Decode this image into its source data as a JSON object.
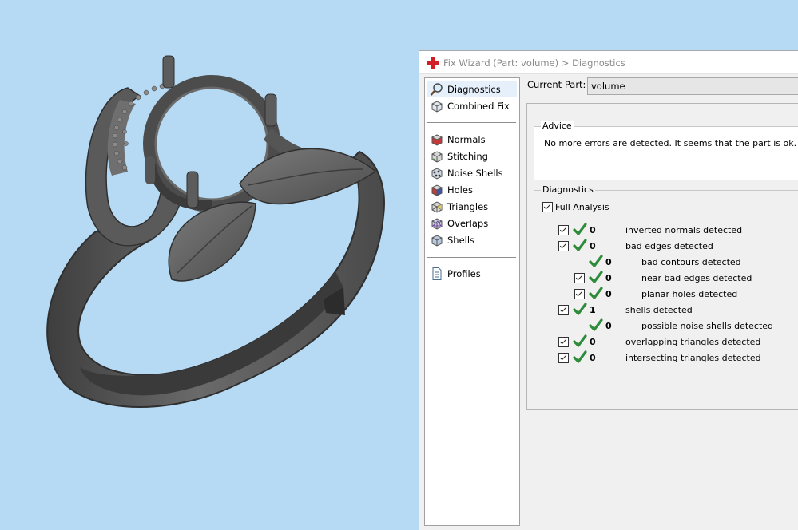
{
  "window": {
    "title": "Fix Wizard (Part: volume) > Diagnostics",
    "icon": "red-cross-icon"
  },
  "nav": {
    "top_items": [
      {
        "label": "Diagnostics",
        "icon": "magnifier-icon",
        "selected": true
      },
      {
        "label": "Combined Fix",
        "icon": "cube-icon",
        "selected": false
      }
    ],
    "tool_items": [
      {
        "label": "Normals",
        "icon": "normals-cube-icon"
      },
      {
        "label": "Stitching",
        "icon": "stitching-cube-icon"
      },
      {
        "label": "Noise Shells",
        "icon": "noise-shells-icon"
      },
      {
        "label": "Holes",
        "icon": "holes-cube-icon"
      },
      {
        "label": "Triangles",
        "icon": "triangles-cube-icon"
      },
      {
        "label": "Overlaps",
        "icon": "overlaps-cube-icon"
      },
      {
        "label": "Shells",
        "icon": "shells-cube-icon"
      }
    ],
    "bottom_items": [
      {
        "label": "Profiles",
        "icon": "document-icon"
      }
    ]
  },
  "current_part": {
    "label": "Current Part:",
    "value": "volume"
  },
  "advice": {
    "title": "Advice",
    "text": "No more errors are detected. It seems that the part is ok."
  },
  "diagnostics": {
    "title": "Diagnostics",
    "full_analysis": {
      "label": "Full Analysis",
      "checked": true
    },
    "rows": [
      {
        "checked": true,
        "count": "0",
        "label": "inverted normals detected",
        "indent": 0
      },
      {
        "checked": true,
        "count": "0",
        "label": "bad edges detected",
        "indent": 0
      },
      {
        "checked": false,
        "count": "0",
        "label": "bad contours detected",
        "indent": 1
      },
      {
        "checked": true,
        "count": "0",
        "label": "near bad edges detected",
        "indent": 1
      },
      {
        "checked": true,
        "count": "0",
        "label": "planar holes detected",
        "indent": 1
      },
      {
        "checked": true,
        "count": "1",
        "label": "shells detected",
        "indent": 0
      },
      {
        "checked": false,
        "count": "0",
        "label": "possible noise shells detected",
        "indent": 1
      },
      {
        "checked": true,
        "count": "0",
        "label": "overlapping triangles detected",
        "indent": 0
      },
      {
        "checked": true,
        "count": "0",
        "label": "intersecting triangles detected",
        "indent": 0
      }
    ]
  },
  "colors": {
    "viewport_background": "#b6daf4",
    "ok_green": "#2e8b3a",
    "part_gray": "#5d5d5d"
  }
}
